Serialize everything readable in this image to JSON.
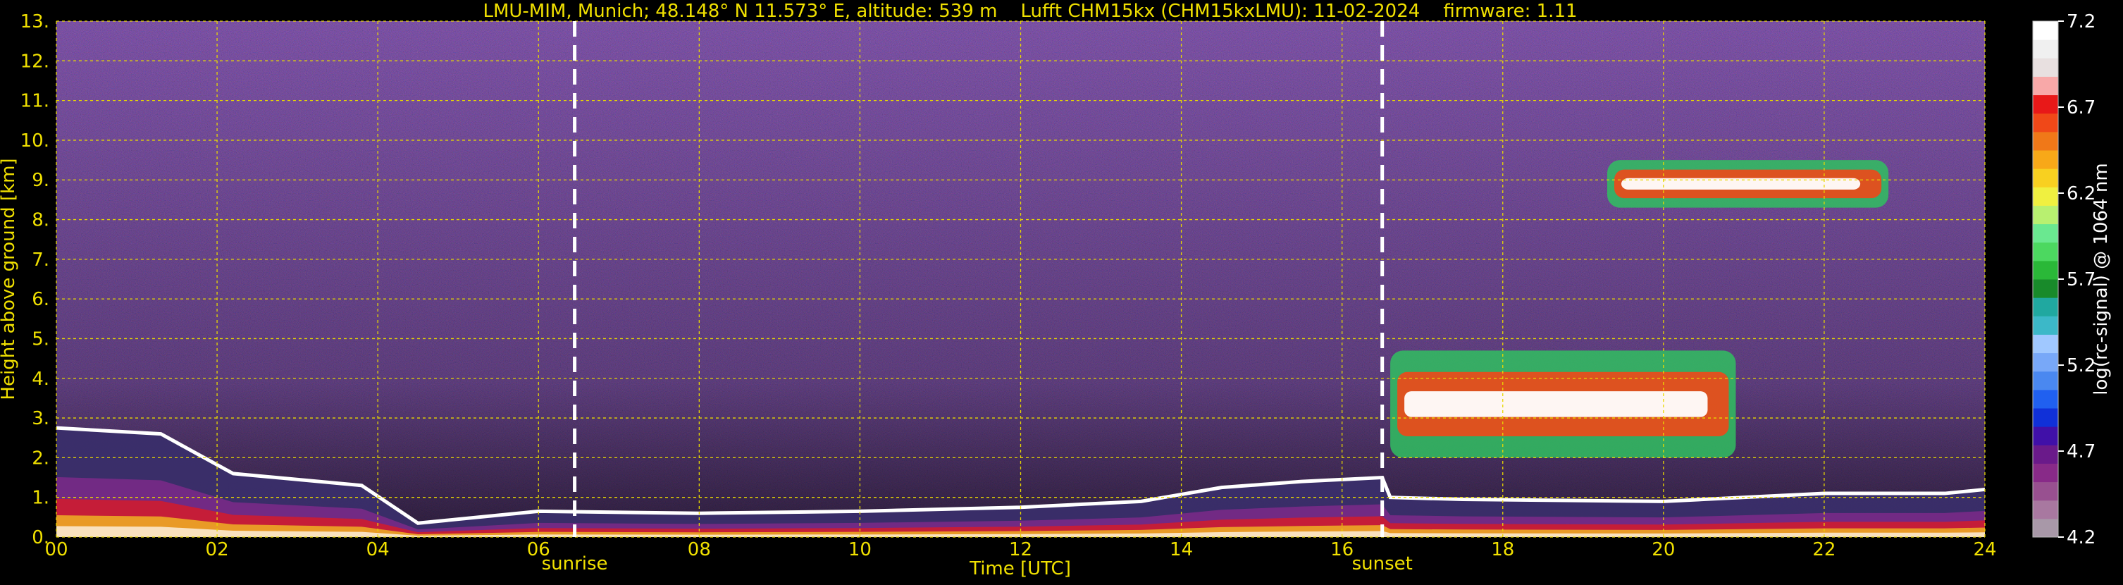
{
  "chart_data": {
    "type": "heatmap",
    "title": "LMU-MIM, Munich; 48.148° N 11.573° E, altitude: 539 m    Lufft CHM15kx (CHM15kxLMU): 11-02-2024    firmware: 1.11",
    "xlabel": "Time [UTC]",
    "ylabel": "Height above ground [km]",
    "xlim": [
      0,
      24
    ],
    "ylim": [
      0,
      13
    ],
    "x_ticks": [
      "00",
      "02",
      "04",
      "06",
      "08",
      "10",
      "12",
      "14",
      "16",
      "18",
      "20",
      "22",
      "24"
    ],
    "x_tick_values": [
      0,
      2,
      4,
      6,
      8,
      10,
      12,
      14,
      16,
      18,
      20,
      22,
      24
    ],
    "y_ticks": [
      "0.",
      "1.",
      "2.",
      "3.",
      "4.",
      "5.",
      "6.",
      "7.",
      "8.",
      "9.",
      "10.",
      "11.",
      "12.",
      "13."
    ],
    "y_tick_values": [
      0,
      1,
      2,
      3,
      4,
      5,
      6,
      7,
      8,
      9,
      10,
      11,
      12,
      13
    ],
    "grid": true,
    "annotations": [
      {
        "label": "sunrise",
        "x": 6.45
      },
      {
        "label": "sunset",
        "x": 16.5
      }
    ],
    "colorbar": {
      "label": "log(rc-signal) @ 1064 nm",
      "range": [
        4.2,
        7.2
      ],
      "ticks": [
        "7.2",
        "6.7",
        "6.2",
        "5.7",
        "5.2",
        "4.7",
        "4.2"
      ],
      "tick_values": [
        7.2,
        6.7,
        6.2,
        5.7,
        5.2,
        4.7,
        4.2
      ],
      "colors": [
        "#a898a8",
        "#a878a0",
        "#985090",
        "#882a88",
        "#6a1a8a",
        "#4010a8",
        "#1030d8",
        "#2060f0",
        "#4a88f0",
        "#78a8f8",
        "#a0c8ff",
        "#3cb8c8",
        "#20a8a0",
        "#188a2a",
        "#2ab838",
        "#4cd860",
        "#6ae890",
        "#b8f070",
        "#f0f040",
        "#f8d020",
        "#f8a818",
        "#f07818",
        "#f04818",
        "#e81818",
        "#f8a8a8",
        "#e8e0e0",
        "#f0f0f0",
        "#ffffff"
      ]
    },
    "features": [
      {
        "name": "boundary layer",
        "x": [
          0,
          1.3,
          2.2,
          3.8,
          4.5,
          6.0,
          8.0,
          10.0,
          12.0,
          13.5,
          14.5,
          15.5,
          16.5,
          16.6,
          17.5,
          20.0,
          22.0,
          23.5,
          24.0
        ],
        "top_km": [
          2.75,
          2.6,
          1.6,
          1.3,
          0.35,
          0.65,
          0.6,
          0.65,
          0.75,
          0.9,
          1.25,
          1.4,
          1.5,
          1.0,
          0.95,
          0.9,
          1.1,
          1.1,
          1.2
        ]
      },
      {
        "name": "residual layer",
        "x_range": [
          16.6,
          20.9
        ],
        "base_km": 2.0,
        "top_km": 4.7
      },
      {
        "name": "cirrus",
        "x_range": [
          19.3,
          22.8
        ],
        "base_km": 8.3,
        "top_km": 9.5
      }
    ]
  }
}
